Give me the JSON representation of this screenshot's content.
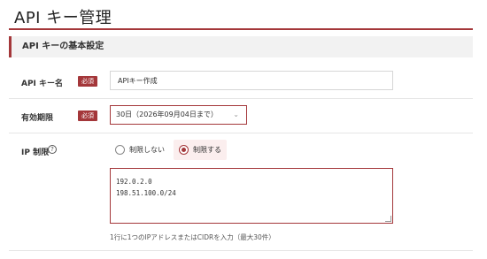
{
  "header": {
    "title": "API キー管理"
  },
  "section": {
    "title": "API キーの基本設定"
  },
  "fields": {
    "name": {
      "label": "API キー名",
      "required_badge": "必須",
      "value": "APIキー作成"
    },
    "expiry": {
      "label": "有効期限",
      "required_badge": "必須",
      "selected": "30日（2026年09月04日まで）"
    },
    "ip_restriction": {
      "label": "IP 制限",
      "options": [
        {
          "label": "制限しない",
          "selected": false
        },
        {
          "label": "制限する",
          "selected": true
        }
      ],
      "lines": [
        "192.0.2.0",
        "198.51.100.0/24"
      ],
      "hint": "1行に1つのIPアドレスまたはCIDRを入力（最大30件）"
    }
  },
  "icons": {
    "help": "question-circle-icon",
    "chevron": "chevron-down-icon"
  },
  "colors": {
    "accent": "#a4373a",
    "section_bg": "#f2f2f2",
    "selected_bg": "#fbeeee"
  }
}
